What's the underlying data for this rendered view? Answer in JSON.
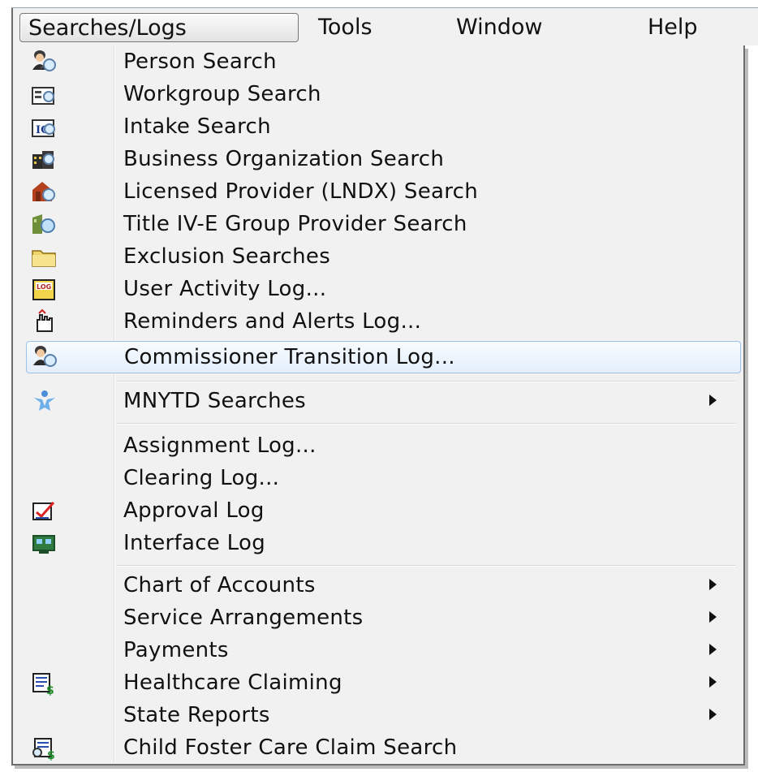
{
  "menubar": {
    "items": [
      {
        "label": "Searches/Logs",
        "active": true
      },
      {
        "label": "Tools",
        "active": false
      },
      {
        "label": "Window",
        "active": false
      },
      {
        "label": "Help",
        "active": false
      }
    ]
  },
  "menu": {
    "items": [
      {
        "label": "Person Search",
        "icon": "person-search-icon"
      },
      {
        "label": "Workgroup Search",
        "icon": "workgroup-search-icon"
      },
      {
        "label": "Intake Search",
        "icon": "intake-search-icon"
      },
      {
        "label": "Business Organization Search",
        "icon": "business-org-search-icon"
      },
      {
        "label": "Licensed Provider (LNDX) Search",
        "icon": "licensed-provider-search-icon"
      },
      {
        "label": "Title IV-E Group Provider Search",
        "icon": "group-provider-search-icon"
      },
      {
        "label": "Exclusion Searches",
        "icon": "folder-icon"
      },
      {
        "label": "User Activity Log...",
        "icon": "log-icon"
      },
      {
        "label": "Reminders and Alerts Log...",
        "icon": "reminder-hand-icon"
      },
      {
        "label": "Commissioner Transition Log...",
        "icon": "person-search-icon",
        "highlighted": true
      },
      {
        "label": "MNYTD Searches",
        "icon": "mnytd-person-icon",
        "submenu": true
      },
      {
        "label": "Assignment Log...",
        "icon": ""
      },
      {
        "label": "Clearing Log...",
        "icon": ""
      },
      {
        "label": "Approval Log",
        "icon": "approval-check-icon"
      },
      {
        "label": "Interface Log",
        "icon": "interface-log-icon"
      },
      {
        "label": "Chart of Accounts",
        "icon": "",
        "submenu": true
      },
      {
        "label": "Service Arrangements",
        "icon": "",
        "submenu": true
      },
      {
        "label": "Payments",
        "icon": "",
        "submenu": true
      },
      {
        "label": "Healthcare Claiming",
        "icon": "claim-dollar-icon",
        "submenu": true
      },
      {
        "label": "State Reports",
        "icon": "",
        "submenu": true
      },
      {
        "label": "Child Foster Care Claim Search",
        "icon": "claim-search-dollar-icon"
      }
    ]
  },
  "colors": {
    "menu_background": "#f1f1f1",
    "highlight_border": "#9ec3ea",
    "text": "#111111"
  }
}
